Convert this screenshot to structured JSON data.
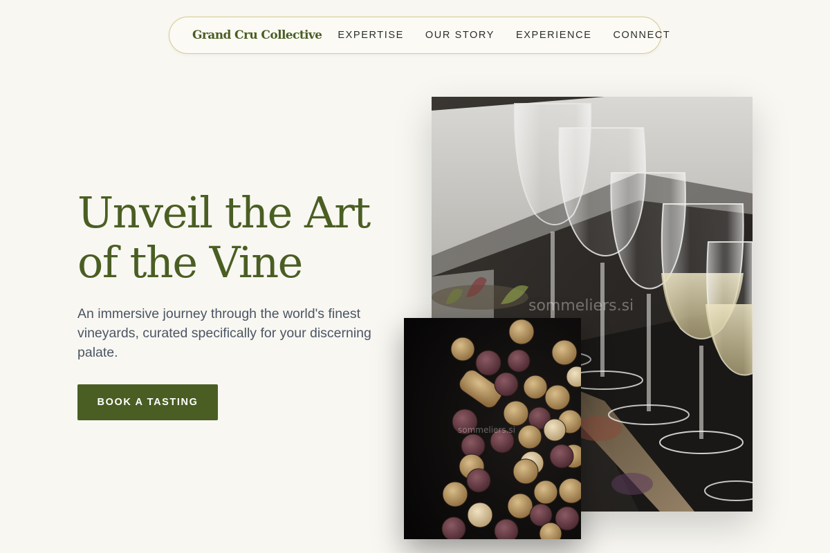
{
  "nav": {
    "brand": "Grand Cru Collective",
    "links": [
      "EXPERTISE",
      "OUR STORY",
      "EXPERIENCE",
      "CONNECT"
    ]
  },
  "hero": {
    "title_line1": "Unveil the Art",
    "title_line2": "of the Vine",
    "subtitle": "An immersive journey through the world's finest vineyards, curated specifically for your discerning palate.",
    "cta": "BOOK A TASTING"
  },
  "images": {
    "glasses_watermark": "sommeliers.si",
    "corks_watermark": "sommeliers.si"
  },
  "colors": {
    "accent": "#4a5e23",
    "background": "#f8f7f2",
    "nav_border": "#d6c98e",
    "body_text": "#4b5563"
  },
  "icons": {
    "glasses_photo": "wine-glasses-photo",
    "corks_photo": "wine-corks-photo"
  }
}
